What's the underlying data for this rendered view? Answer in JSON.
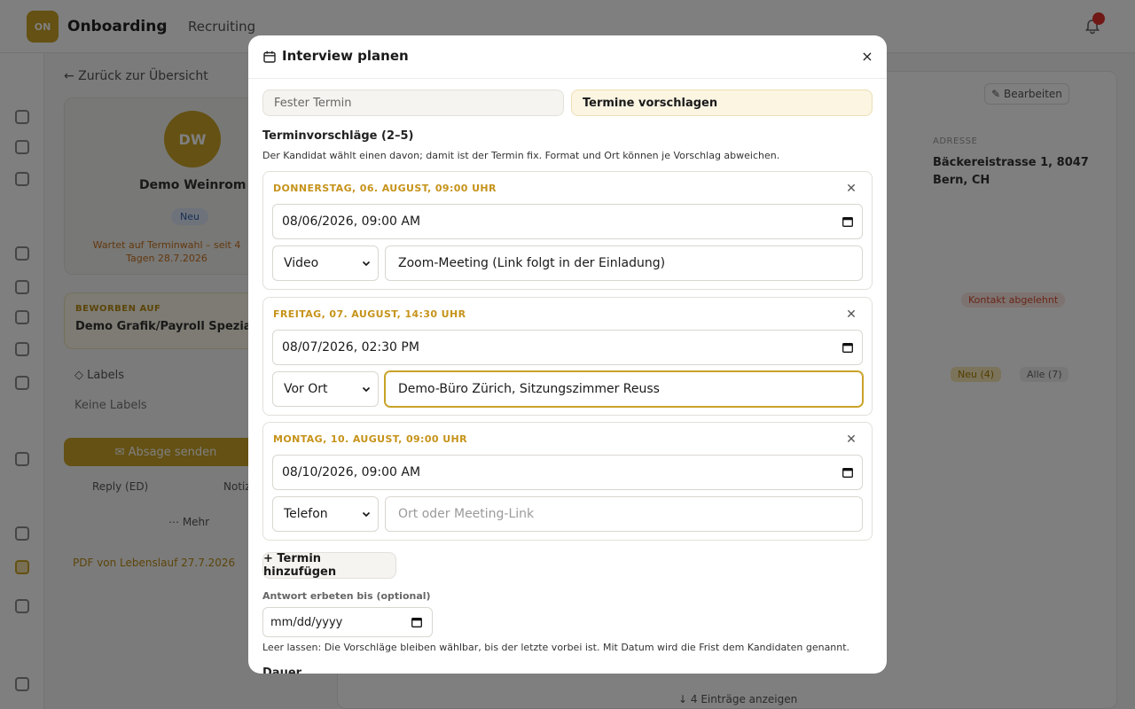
{
  "app": {
    "logo_initials": "ON",
    "workspace": "Onboarding",
    "workspace_caret": "⌄",
    "breadcrumb": "Recruiting",
    "back_link": "← Zurück zur Übersicht",
    "candidate": {
      "initials": "DW",
      "name": "Demo Weinrom",
      "status_badge": "Neu",
      "warning": "Wartet auf Terminwahl – seit 4 Tagen 28.7.2026"
    },
    "pipeline": {
      "label": "BEWORBEN AUF",
      "value": "Demo Grafik/Payroll Spezialist/in"
    },
    "labels_heading": "◇ Labels",
    "labels_empty": "Keine Labels",
    "primary_action": "✉ Absage senden",
    "secondary_actions": [
      "Reply (ED)",
      "Notiz"
    ],
    "more_action": "⋯ Mehr",
    "file_note": "PDF von Lebenslauf 27.7.2026",
    "edit_button": "✎ Bearbeiten",
    "address_label": "ADRESSE",
    "address_lines": [
      "Bäckereistrasse 1, 8047",
      "Bern, CH"
    ],
    "pill_red": "Kontakt abgelehnt",
    "pill_gold": "Neu (4)",
    "pill_grey": "Alle (7)",
    "show_all": "↓ 4 Einträge anzeigen"
  },
  "modal": {
    "title": "Interview planen",
    "close_label": "×",
    "mode_tabs": [
      {
        "label": "Fester Termin",
        "active": false
      },
      {
        "label": "Termine vorschlagen",
        "active": true
      }
    ],
    "section_title": "Terminvorschläge (2–5)",
    "section_help": "Der Kandidat wählt einen davon; damit ist der Termin fix. Format und Ort können je Vorschlag abweichen.",
    "slots": [
      {
        "heading": "DONNERSTAG, 06. AUGUST, 09:00 UHR",
        "datetime": "08/06/2026, 09:00 AM",
        "format": "Video",
        "location": "Zoom-Meeting (Link folgt in der Einladung)",
        "location_placeholder": ""
      },
      {
        "heading": "FREITAG, 07. AUGUST, 14:30 UHR",
        "datetime": "08/07/2026, 02:30 PM",
        "format": "Vor Ort",
        "location": "Demo-Büro Zürich, Sitzungszimmer Reuss",
        "location_placeholder": ""
      },
      {
        "heading": "MONTAG, 10. AUGUST, 09:00 UHR",
        "datetime": "08/10/2026, 09:00 AM",
        "format": "Telefon",
        "location": "",
        "location_placeholder": "Ort oder Meeting-Link"
      }
    ],
    "add_slot_button": "+ Termin hinzufügen",
    "deadline_label": "Antwort erbeten bis (optional)",
    "deadline_placeholder": "mm/dd/yyyy",
    "deadline_help": "Leer lassen: Die Vorschläge bleiben wählbar, bis der letzte vorbei ist. Mit Datum wird die Frist dem Kandidaten genannt.",
    "duration_label": "Dauer"
  },
  "colors": {
    "accent": "#c9a227",
    "slot_heading": "#c6931a",
    "overlay": "rgba(0,0,0,0.5)"
  },
  "icons": [
    "calendar-icon",
    "close-icon",
    "bell-icon",
    "chevron-down-icon"
  ]
}
